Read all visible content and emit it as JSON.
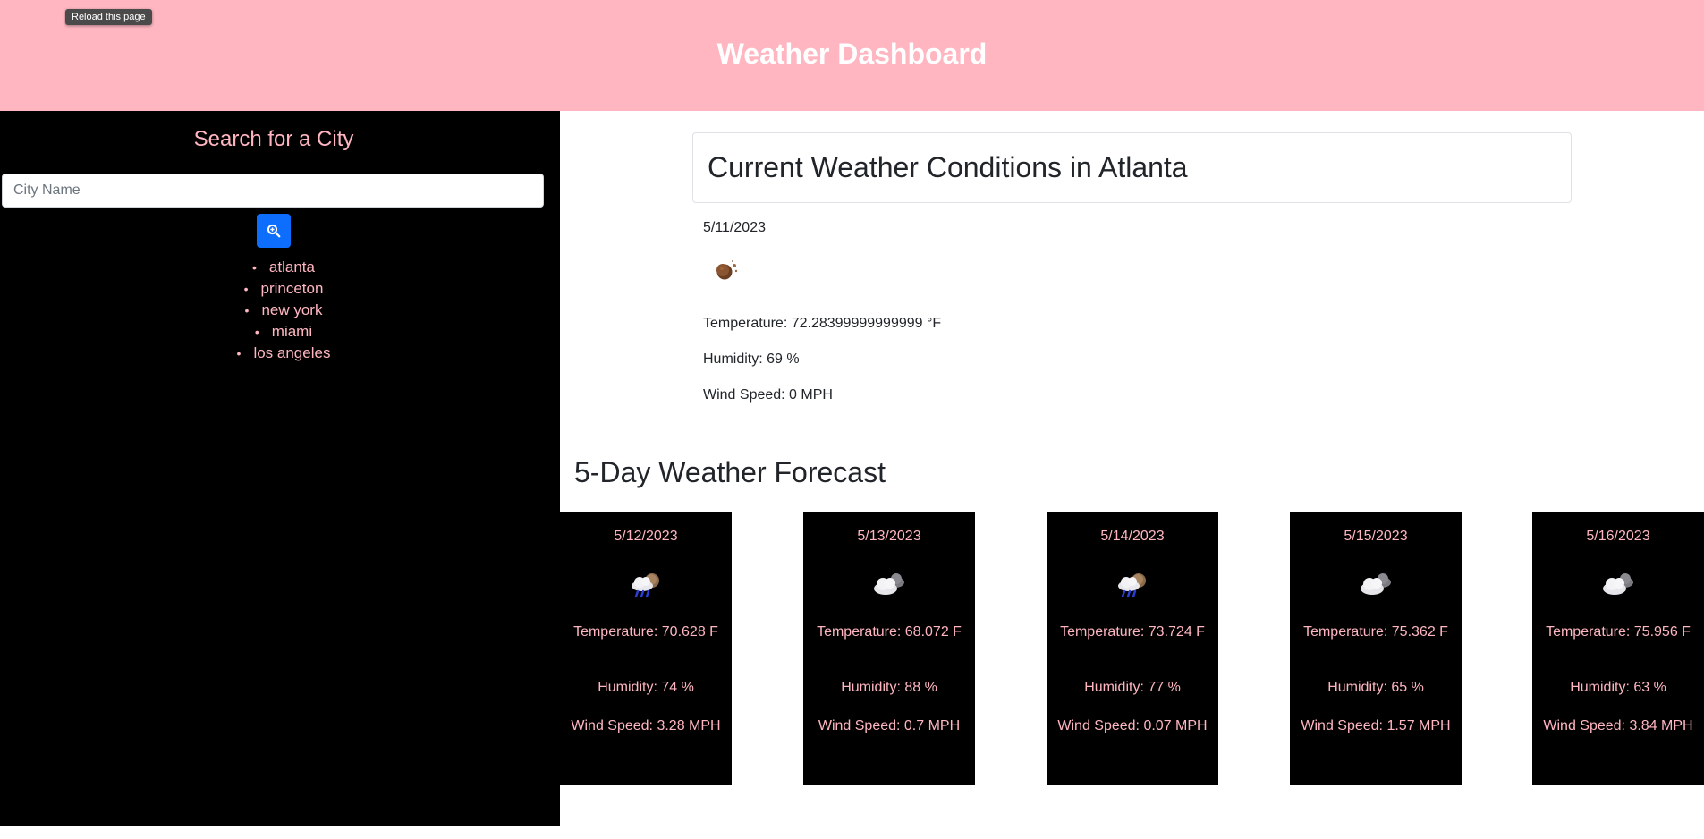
{
  "tooltip": "Reload this page",
  "header": {
    "title": "Weather Dashboard"
  },
  "sidebar": {
    "title": "Search for a City",
    "search_placeholder": "City Name",
    "search_button_icon": "search-zoom-icon",
    "history": [
      "atlanta",
      "princeton",
      "new york",
      "miami",
      "los angeles"
    ]
  },
  "current": {
    "title": "Current Weather Conditions in Atlanta",
    "date": "5/11/2023",
    "icon": "night-moon-haze-icon",
    "temperature": "Temperature: 72.28399999999999 °F",
    "humidity": "Humidity: 69 %",
    "wind": "Wind Speed: 0 MPH"
  },
  "forecast": {
    "title": "5-Day Weather Forecast",
    "days": [
      {
        "date": "5/12/2023",
        "icon": "rain-cloud-moon-icon",
        "temperature": "Temperature: 70.628 F",
        "humidity": "Humidity: 74 %",
        "wind": "Wind Speed: 3.28 MPH"
      },
      {
        "date": "5/13/2023",
        "icon": "cloud-night-icon",
        "temperature": "Temperature: 68.072 F",
        "humidity": "Humidity: 88 %",
        "wind": "Wind Speed: 0.7 MPH"
      },
      {
        "date": "5/14/2023",
        "icon": "rain-cloud-moon-icon",
        "temperature": "Temperature: 73.724 F",
        "humidity": "Humidity: 77 %",
        "wind": "Wind Speed: 0.07 MPH"
      },
      {
        "date": "5/15/2023",
        "icon": "cloud-night-icon",
        "temperature": "Temperature: 75.362 F",
        "humidity": "Humidity: 65 %",
        "wind": "Wind Speed: 1.57 MPH"
      },
      {
        "date": "5/16/2023",
        "icon": "cloud-night-icon",
        "temperature": "Temperature: 75.956 F",
        "humidity": "Humidity: 63 %",
        "wind": "Wind Speed: 3.84 MPH"
      }
    ]
  },
  "colors": {
    "header_bg": "#ffb6c1",
    "accent_pink": "#ffb6c1",
    "sidebar_bg": "#000000",
    "button_blue": "#0d6efd"
  }
}
